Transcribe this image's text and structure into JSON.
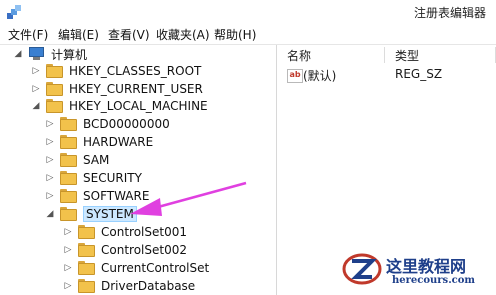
{
  "window": {
    "title": "注册表编辑器",
    "app_icon": "regedit-icon"
  },
  "menu": [
    "文件(F)",
    "编辑(E)",
    "查看(V)",
    "收藏夹(A)",
    "帮助(H)"
  ],
  "tree": {
    "root": "计算机",
    "nodes": [
      {
        "label": "HKEY_CLASSES_ROOT",
        "expanded": false
      },
      {
        "label": "HKEY_CURRENT_USER",
        "expanded": false
      },
      {
        "label": "HKEY_LOCAL_MACHINE",
        "expanded": true
      },
      {
        "label": "BCD00000000",
        "expanded": false
      },
      {
        "label": "HARDWARE",
        "expanded": false
      },
      {
        "label": "SAM",
        "expanded": false
      },
      {
        "label": "SECURITY",
        "expanded": false
      },
      {
        "label": "SOFTWARE",
        "expanded": false
      },
      {
        "label": "SYSTEM",
        "expanded": true,
        "selected": true
      },
      {
        "label": "ControlSet001",
        "expanded": false
      },
      {
        "label": "ControlSet002",
        "expanded": false
      },
      {
        "label": "CurrentControlSet",
        "expanded": false
      },
      {
        "label": "DriverDatabase",
        "expanded": false
      }
    ]
  },
  "values_panel": {
    "headers": {
      "name": "名称",
      "type": "类型"
    },
    "rows": [
      {
        "name": "(默认)",
        "type": "REG_SZ",
        "icon": "ab-string-icon"
      }
    ]
  },
  "annotation": {
    "arrow_color": "#e040e0"
  },
  "watermark": {
    "text": "这里教程网",
    "url": "herecours.com"
  }
}
